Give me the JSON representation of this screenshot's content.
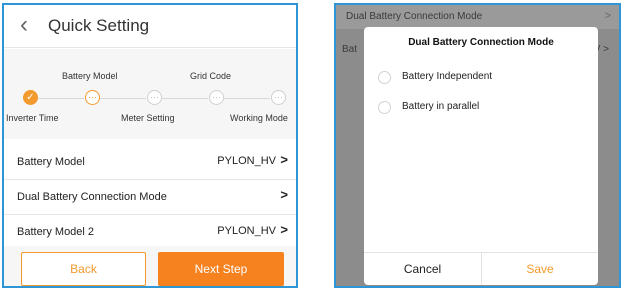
{
  "quick_setting": {
    "title": "Quick Setting",
    "back_icon": "chevron-left-icon",
    "steps": {
      "top_labels": [
        "Battery Model",
        "Grid Code"
      ],
      "bottom_labels": [
        "Inverter Time",
        "Meter Setting",
        "Working Mode"
      ],
      "states": [
        "done",
        "active",
        "pending",
        "pending",
        "pending"
      ]
    },
    "rows": [
      {
        "label": "Battery Model",
        "value": "PYLON_HV",
        "arrow": ">"
      },
      {
        "label": "Dual Battery Connection Mode",
        "value": "",
        "arrow": ">"
      },
      {
        "label": "Battery Model 2",
        "value": "PYLON_HV",
        "arrow": ">"
      }
    ],
    "buttons": {
      "back": "Back",
      "next": "Next Step"
    }
  },
  "dialog_screen": {
    "background_rows": [
      {
        "label": "Dual Battery Connection Mode",
        "arrow": ">"
      },
      {
        "label": "Bat",
        "value": "V >"
      }
    ],
    "dialog": {
      "title": "Dual Battery Connection Mode",
      "options": [
        "Battery Independent",
        "Battery in parallel"
      ],
      "cancel": "Cancel",
      "save": "Save"
    }
  },
  "colors": {
    "accent": "#f29a2e",
    "frame": "#2f96d6"
  }
}
